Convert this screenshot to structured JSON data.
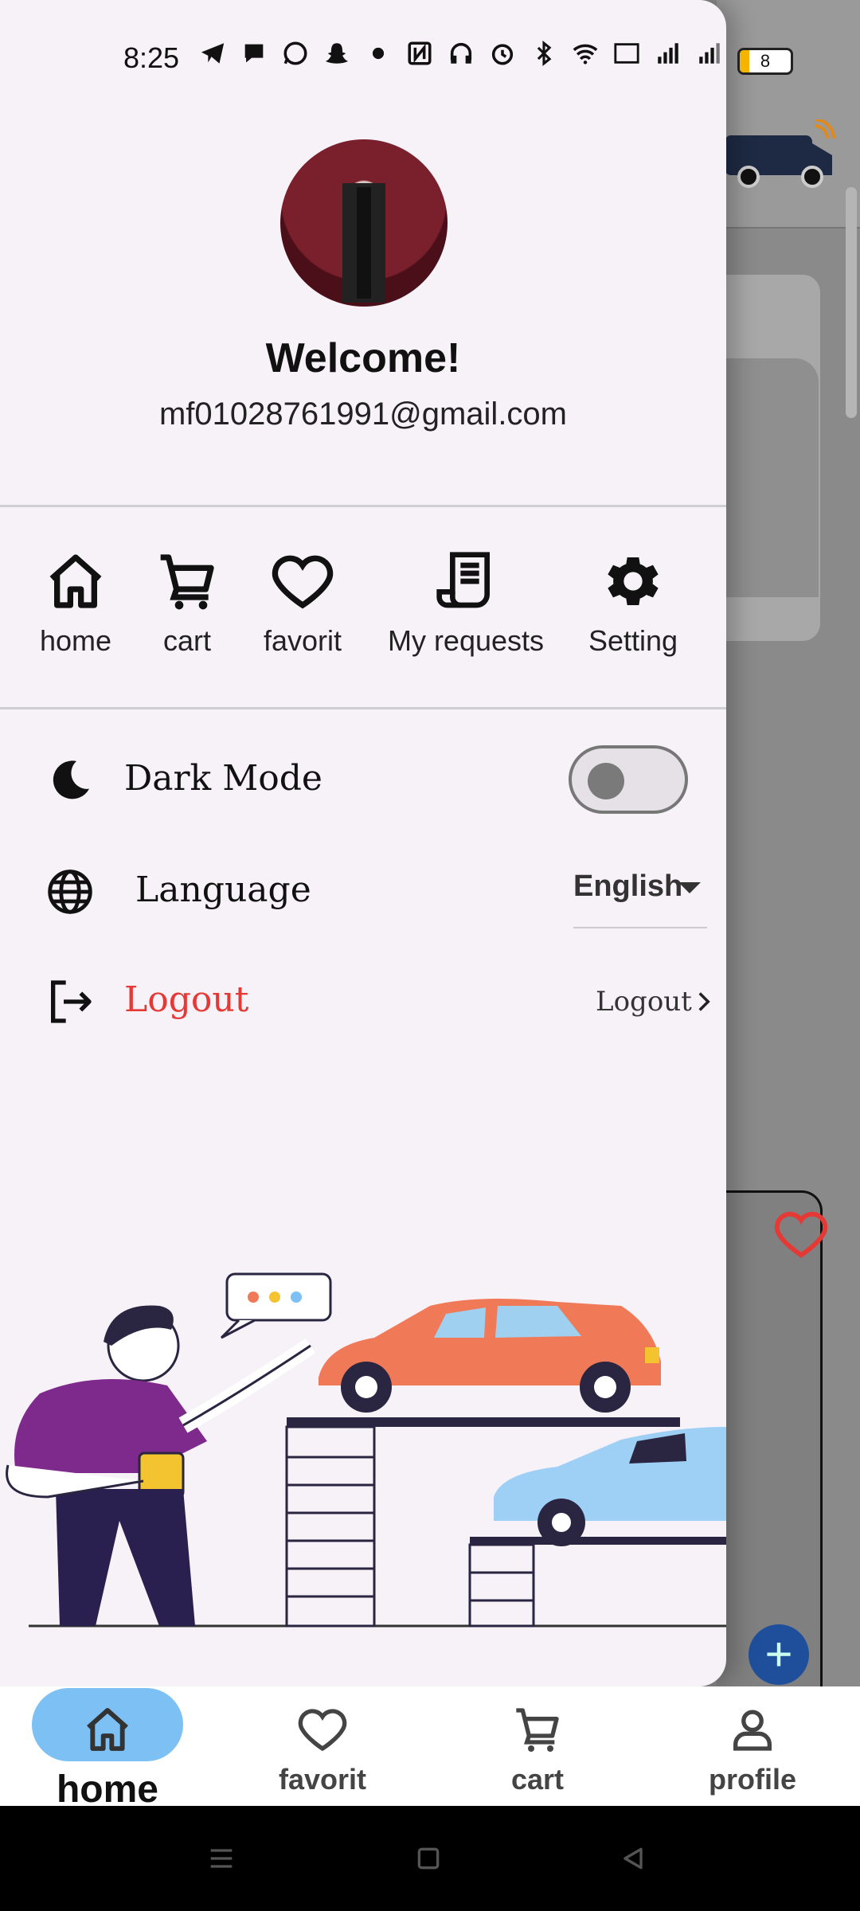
{
  "status_bar": {
    "time": "8:25",
    "battery": "8"
  },
  "drawer": {
    "welcome": "Welcome!",
    "email": "mf01028761991@gmail.com",
    "quick_nav": [
      {
        "label": "home",
        "icon": "home-icon"
      },
      {
        "label": "cart",
        "icon": "cart-icon"
      },
      {
        "label": "favorit",
        "icon": "heart-icon"
      },
      {
        "label": "My requests",
        "icon": "receipt-icon"
      },
      {
        "label": "Setting",
        "icon": "gear-icon"
      }
    ],
    "dark_mode": {
      "label": "Dark Mode",
      "icon": "moon-icon",
      "enabled": false
    },
    "language": {
      "label": "Language",
      "icon": "globe-icon",
      "value": "English"
    },
    "logout": {
      "label": "Logout",
      "link": "Logout",
      "icon": "logout-icon"
    }
  },
  "bottom_nav": [
    {
      "label": "home",
      "icon": "home-icon",
      "active": true
    },
    {
      "label": "favorit",
      "icon": "heart-icon",
      "active": false
    },
    {
      "label": "cart",
      "icon": "cart-icon",
      "active": false
    },
    {
      "label": "profile",
      "icon": "person-icon",
      "active": false
    }
  ],
  "colors": {
    "logout": "#e53935",
    "active_pill": "#7cc0f4",
    "drawer_bg": "#f7f1f8"
  }
}
